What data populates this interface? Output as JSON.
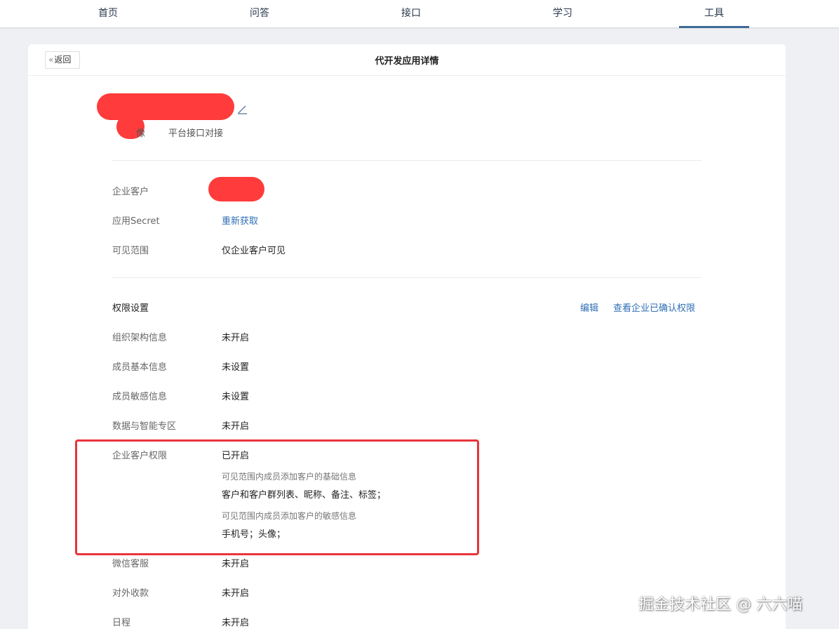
{
  "nav": {
    "tabs": [
      "首页",
      "问答",
      "接口",
      "学习",
      "工具"
    ],
    "active": "工具"
  },
  "header": {
    "back_label": "返回",
    "title": "代开发应用详情"
  },
  "app": {
    "tag": "平台接口对接"
  },
  "info": {
    "customer_label": "企业客户",
    "secret_label": "应用Secret",
    "secret_action": "重新获取",
    "visibility_label": "可见范围",
    "visibility_value": "仅企业客户可见"
  },
  "permissions": {
    "title": "权限设置",
    "edit": "编辑",
    "view_confirmed": "查看企业已确认权限",
    "rows": [
      {
        "label": "组织架构信息",
        "value": "未开启"
      },
      {
        "label": "成员基本信息",
        "value": "未设置"
      },
      {
        "label": "成员敏感信息",
        "value": "未设置"
      },
      {
        "label": "数据与智能专区",
        "value": "未开启"
      },
      {
        "label": "企业客户权限",
        "value": "已开启"
      },
      {
        "label": "微信客服",
        "value": "未开启"
      },
      {
        "label": "对外收款",
        "value": "未开启"
      },
      {
        "label": "日程",
        "value": "未开启"
      }
    ],
    "customer_detail": {
      "basic_label": "可见范围内成员添加客户的基础信息",
      "basic_value": "客户和客户群列表、昵称、备注、标签；",
      "sensitive_label": "可见范围内成员添加客户的敏感信息",
      "sensitive_value": "手机号；头像；"
    }
  },
  "watermark": "掘金技术社区 @ 六六喵",
  "colors": {
    "accent": "#3d6a96",
    "link": "#2f6fb5",
    "highlight": "#e8343a",
    "redaction": "#ff3b3b"
  }
}
